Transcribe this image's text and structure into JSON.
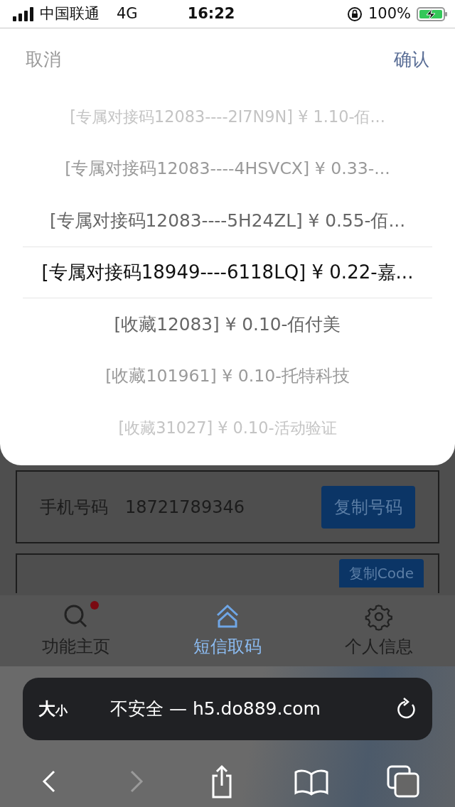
{
  "status_bar": {
    "carrier": "中国联通",
    "network": "4G",
    "time": "16:22",
    "battery": "100%"
  },
  "picker": {
    "cancel": "取消",
    "confirm": "确认",
    "options": [
      {
        "label": "[专属对接码12083----2I7N9N] ¥ 1.10-佰...",
        "selected": false
      },
      {
        "label": "[专属对接码12083----4HSVCX] ¥ 0.33-...",
        "selected": false
      },
      {
        "label": "[专属对接码12083----5H24ZL] ¥ 0.55-佰...",
        "selected": false
      },
      {
        "label": "[专属对接码18949----6118LQ] ¥ 0.22-嘉...",
        "selected": true
      },
      {
        "label": "[收藏12083] ¥ 0.10-佰付美",
        "selected": false
      },
      {
        "label": "[收藏101961] ¥ 0.10-托特科技",
        "selected": false
      },
      {
        "label": "[收藏31027] ¥ 0.10-活动验证",
        "selected": false
      }
    ]
  },
  "page": {
    "phone_label": "手机号码",
    "phone_number": "18721789346",
    "copy_phone_button": "复制号码",
    "copy_code_button": "复制Code"
  },
  "tab_bar": {
    "items": [
      {
        "label": "功能主页",
        "kind": "search",
        "selected": false,
        "badge": true
      },
      {
        "label": "短信取码",
        "kind": "home",
        "selected": true,
        "badge": false
      },
      {
        "label": "个人信息",
        "kind": "gear",
        "selected": false,
        "badge": false
      }
    ]
  },
  "browser": {
    "text_size_large": "大",
    "text_size_small": "小",
    "address": "不安全 — h5.do889.com"
  }
}
